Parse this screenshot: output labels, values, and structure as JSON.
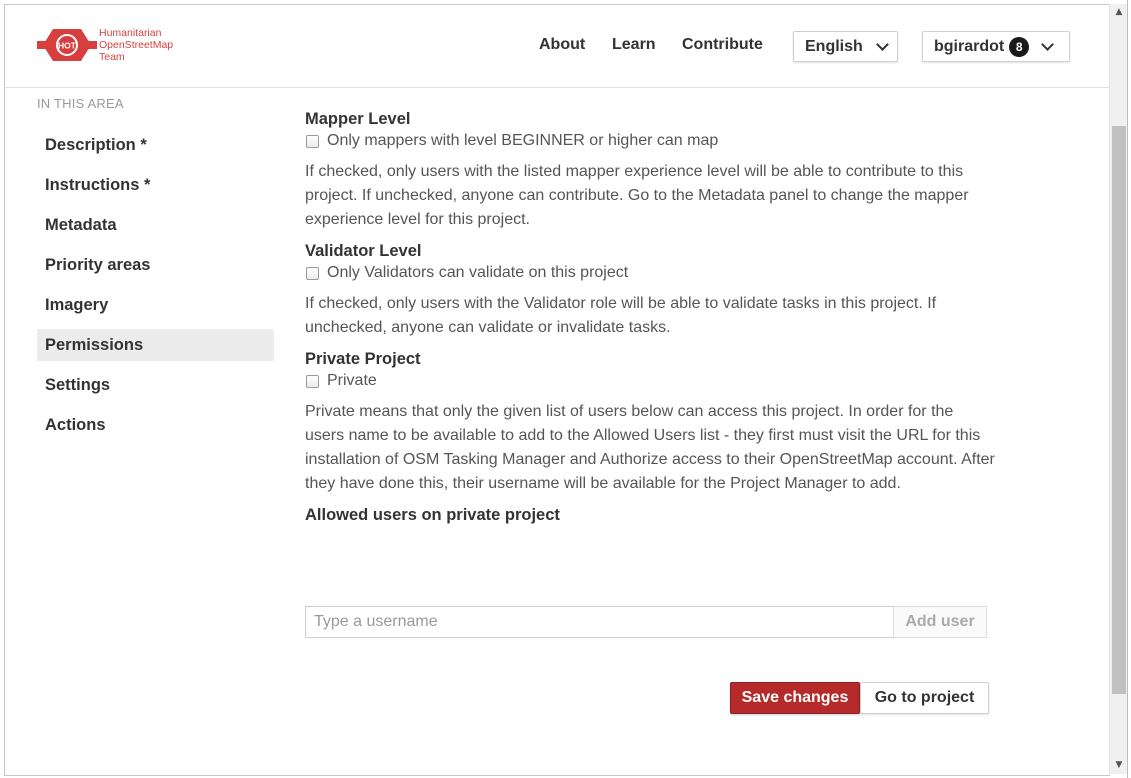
{
  "brand": {
    "logo_text": "HOT",
    "name_lines": [
      "Humanitarian",
      "OpenStreetMap",
      "Team"
    ],
    "color": "#d73f3f"
  },
  "nav": {
    "about": "About",
    "learn": "Learn",
    "contribute": "Contribute",
    "language": "English",
    "username": "bgirardot",
    "notifications": "8"
  },
  "sidebar": {
    "heading": "IN THIS AREA",
    "items": [
      {
        "label": "Description *"
      },
      {
        "label": "Instructions *"
      },
      {
        "label": "Metadata"
      },
      {
        "label": "Priority areas"
      },
      {
        "label": "Imagery"
      },
      {
        "label": "Permissions",
        "active": true
      },
      {
        "label": "Settings"
      },
      {
        "label": "Actions"
      }
    ]
  },
  "permissions": {
    "mapper": {
      "title": "Mapper Level",
      "checkbox": "Only mappers with level BEGINNER or higher can map",
      "description": "If checked, only users with the listed mapper experience level will be able to contribute to this project. If unchecked, anyone can contribute. Go to the Metadata panel to change the mapper experience level for this project."
    },
    "validator": {
      "title": "Validator Level",
      "checkbox": "Only Validators can validate on this project",
      "description": "If checked, only users with the Validator role will be able to validate tasks in this project. If unchecked, anyone can validate or invalidate tasks."
    },
    "private": {
      "title": "Private Project",
      "checkbox": "Private",
      "description": "Private means that only the given list of users below can access this project. In order for the users name to be available to add to the Allowed Users list - they first must visit the URL for this installation of OSM Tasking Manager and Authorize access to their OpenStreetMap account. After they have done this, their username will be available for the Project Manager to add."
    },
    "allowed_users": {
      "title": "Allowed users on private project",
      "placeholder": "Type a username",
      "add_button": "Add user"
    }
  },
  "actions": {
    "save": "Save changes",
    "goto": "Go to project",
    "save_color": "#b52b2b"
  }
}
